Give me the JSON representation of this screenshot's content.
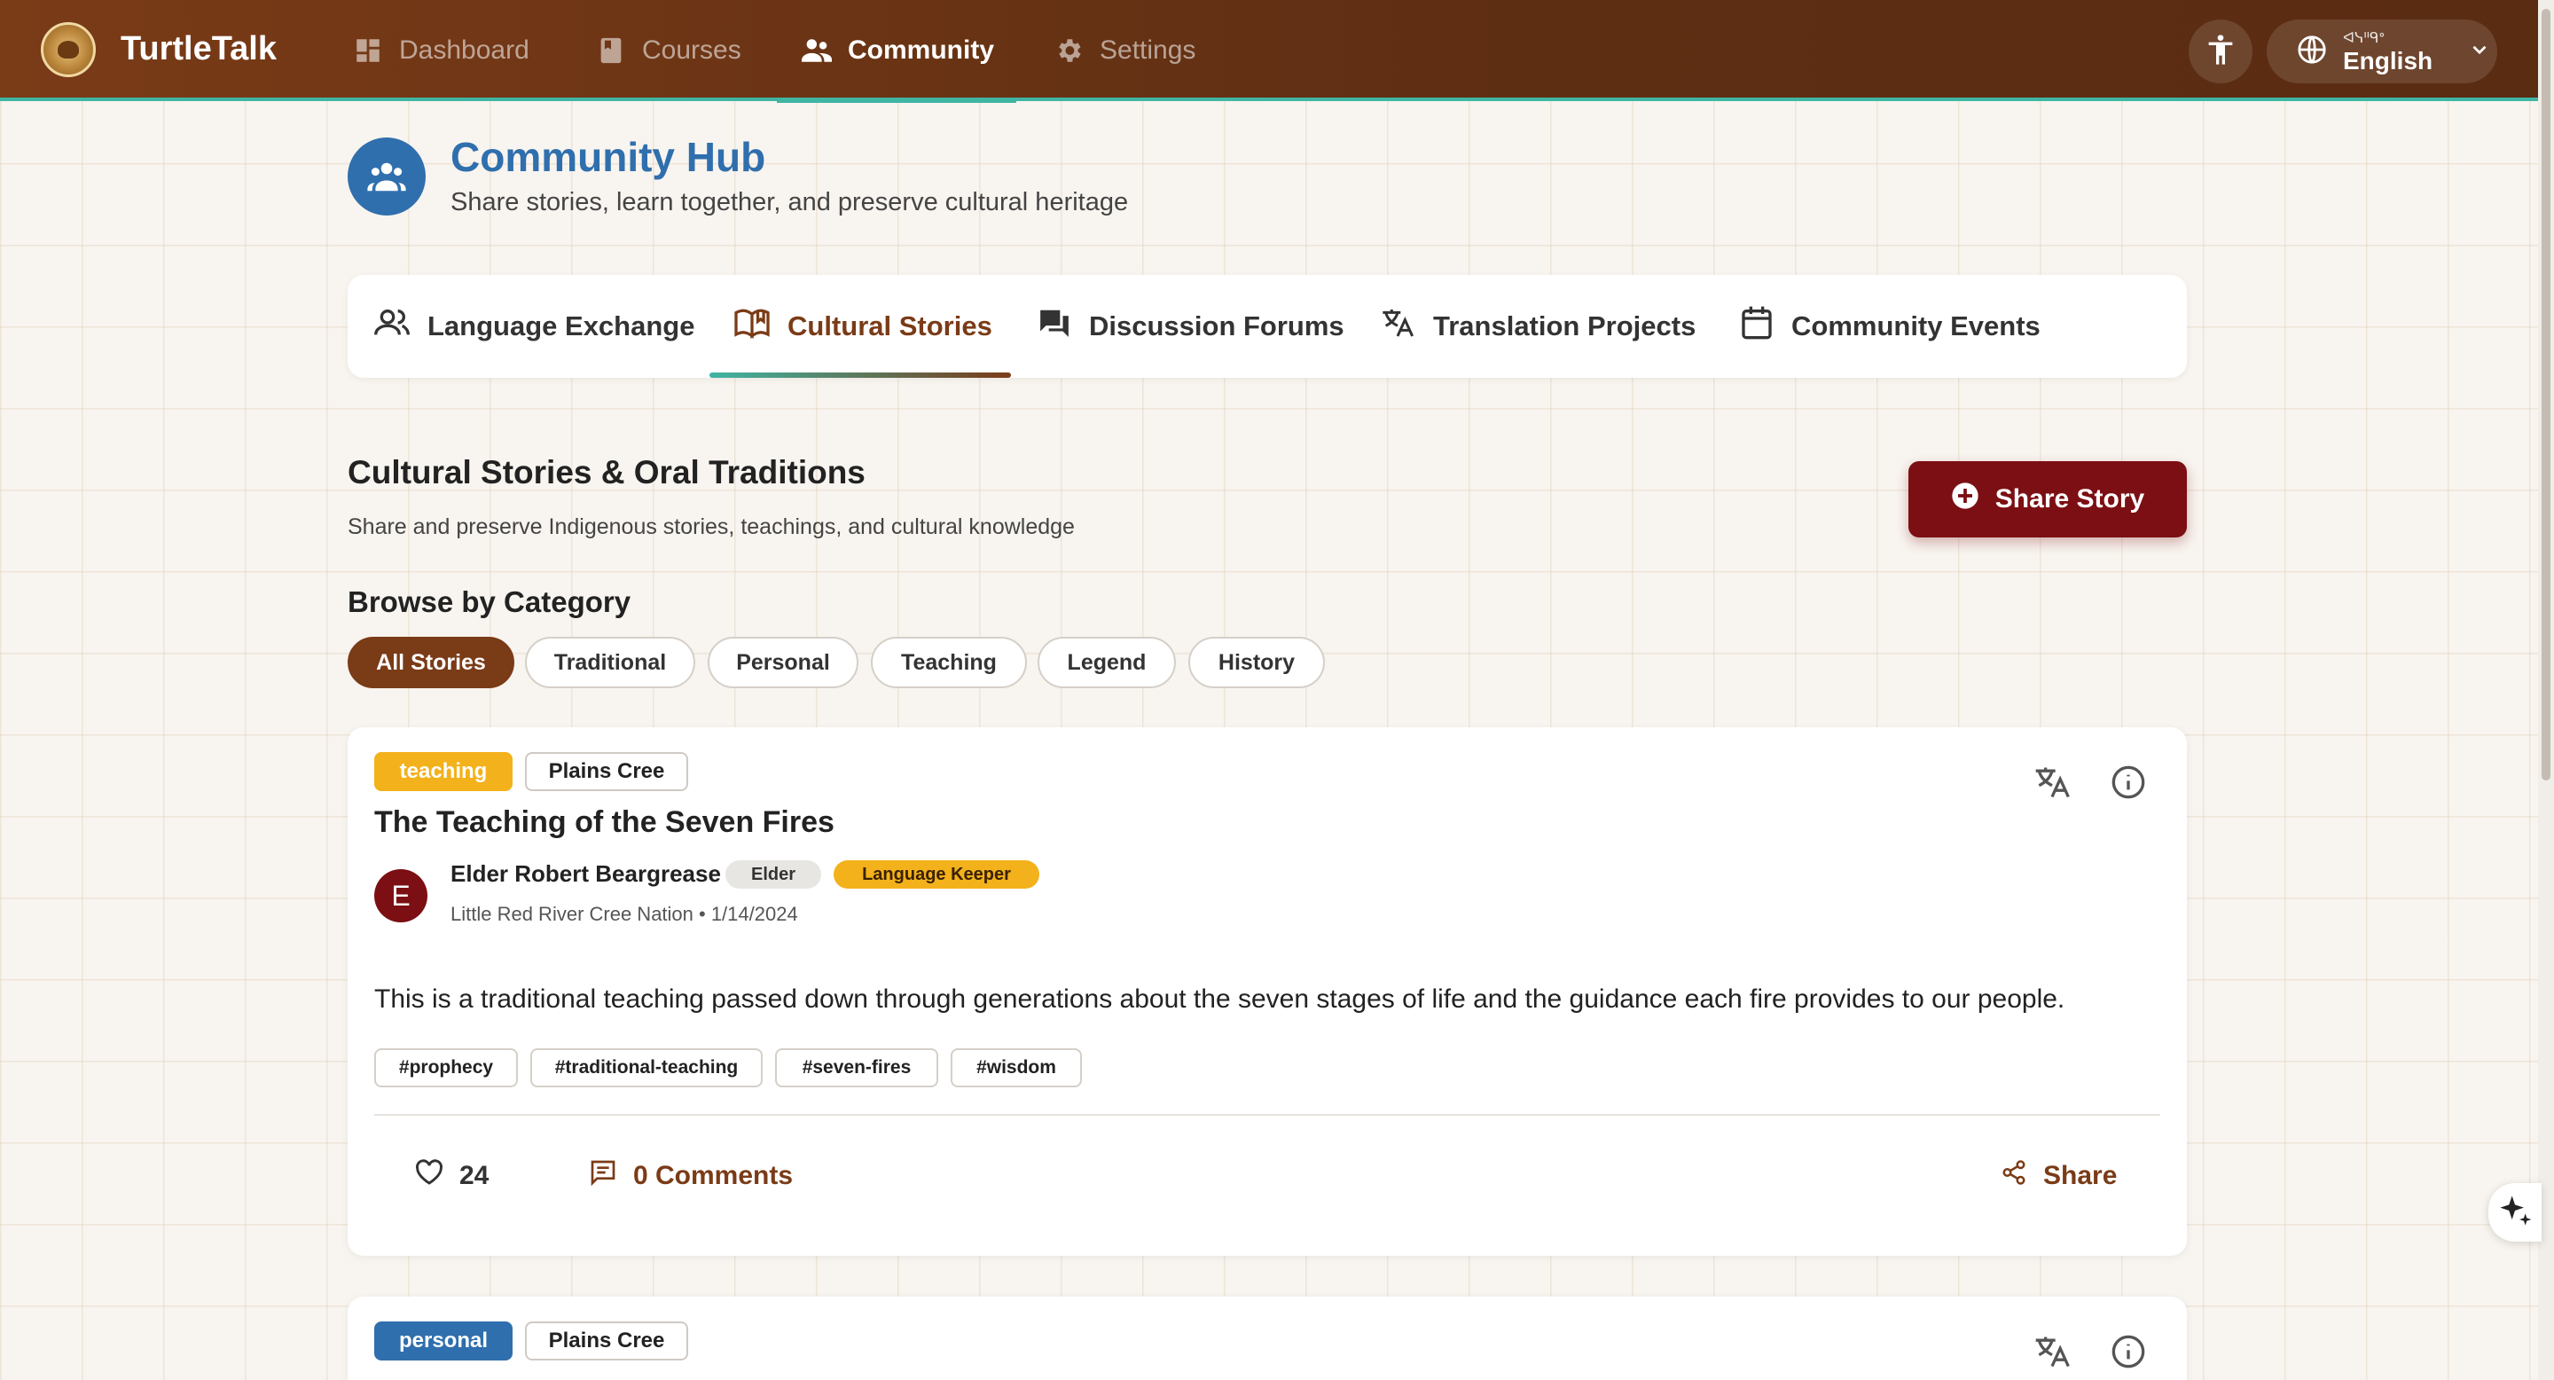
{
  "app": {
    "brand": "TurtleTalk",
    "nav": [
      {
        "label": "Dashboard",
        "icon": "dashboard-icon",
        "active": false
      },
      {
        "label": "Courses",
        "icon": "book-icon",
        "active": false
      },
      {
        "label": "Community",
        "icon": "people-icon",
        "active": true
      },
      {
        "label": "Settings",
        "icon": "gear-icon",
        "active": false
      }
    ],
    "language": {
      "native_label": "ᐊᓭᐦᑫᐤ",
      "label": "English"
    },
    "colors": {
      "header_brown": "#6b3416",
      "teal_accent": "#3fb5a3",
      "primary_blue": "#2f6fad",
      "maroon": "#7b0f13",
      "gold": "#f3b11b"
    }
  },
  "hub": {
    "title": "Community Hub",
    "subtitle": "Share stories, learn together, and preserve cultural heritage"
  },
  "tabs": [
    {
      "label": "Language Exchange",
      "icon": "people-outline-icon",
      "active": false
    },
    {
      "label": "Cultural Stories",
      "icon": "open-book-icon",
      "active": true
    },
    {
      "label": "Discussion Forums",
      "icon": "forum-icon",
      "active": false
    },
    {
      "label": "Translation Projects",
      "icon": "translate-icon",
      "active": false
    },
    {
      "label": "Community Events",
      "icon": "calendar-icon",
      "active": false
    }
  ],
  "section": {
    "title": "Cultural Stories & Oral Traditions",
    "subtitle": "Share and preserve Indigenous stories, teachings, and cultural knowledge",
    "share_button": "Share Story",
    "browse_title": "Browse by Category",
    "categories": [
      "All Stories",
      "Traditional",
      "Personal",
      "Teaching",
      "Legend",
      "History"
    ],
    "active_category": "All Stories"
  },
  "stories": [
    {
      "category": "teaching",
      "language": "Plains Cree",
      "title": "The Teaching of the Seven Fires",
      "author": {
        "initial": "E",
        "name": "Elder Robert Beargrease",
        "roles": [
          "Elder",
          "Language Keeper"
        ]
      },
      "meta": "Little Red River Cree Nation • 1/14/2024",
      "body": "This is a traditional teaching passed down through generations about the seven stages of life and the guidance each fire provides to our people.",
      "tags": [
        "#prophecy",
        "#traditional-teaching",
        "#seven-fires",
        "#wisdom"
      ],
      "likes": "24",
      "comments": "0 Comments",
      "share": "Share"
    },
    {
      "category": "personal",
      "language": "Plains Cree"
    }
  ]
}
